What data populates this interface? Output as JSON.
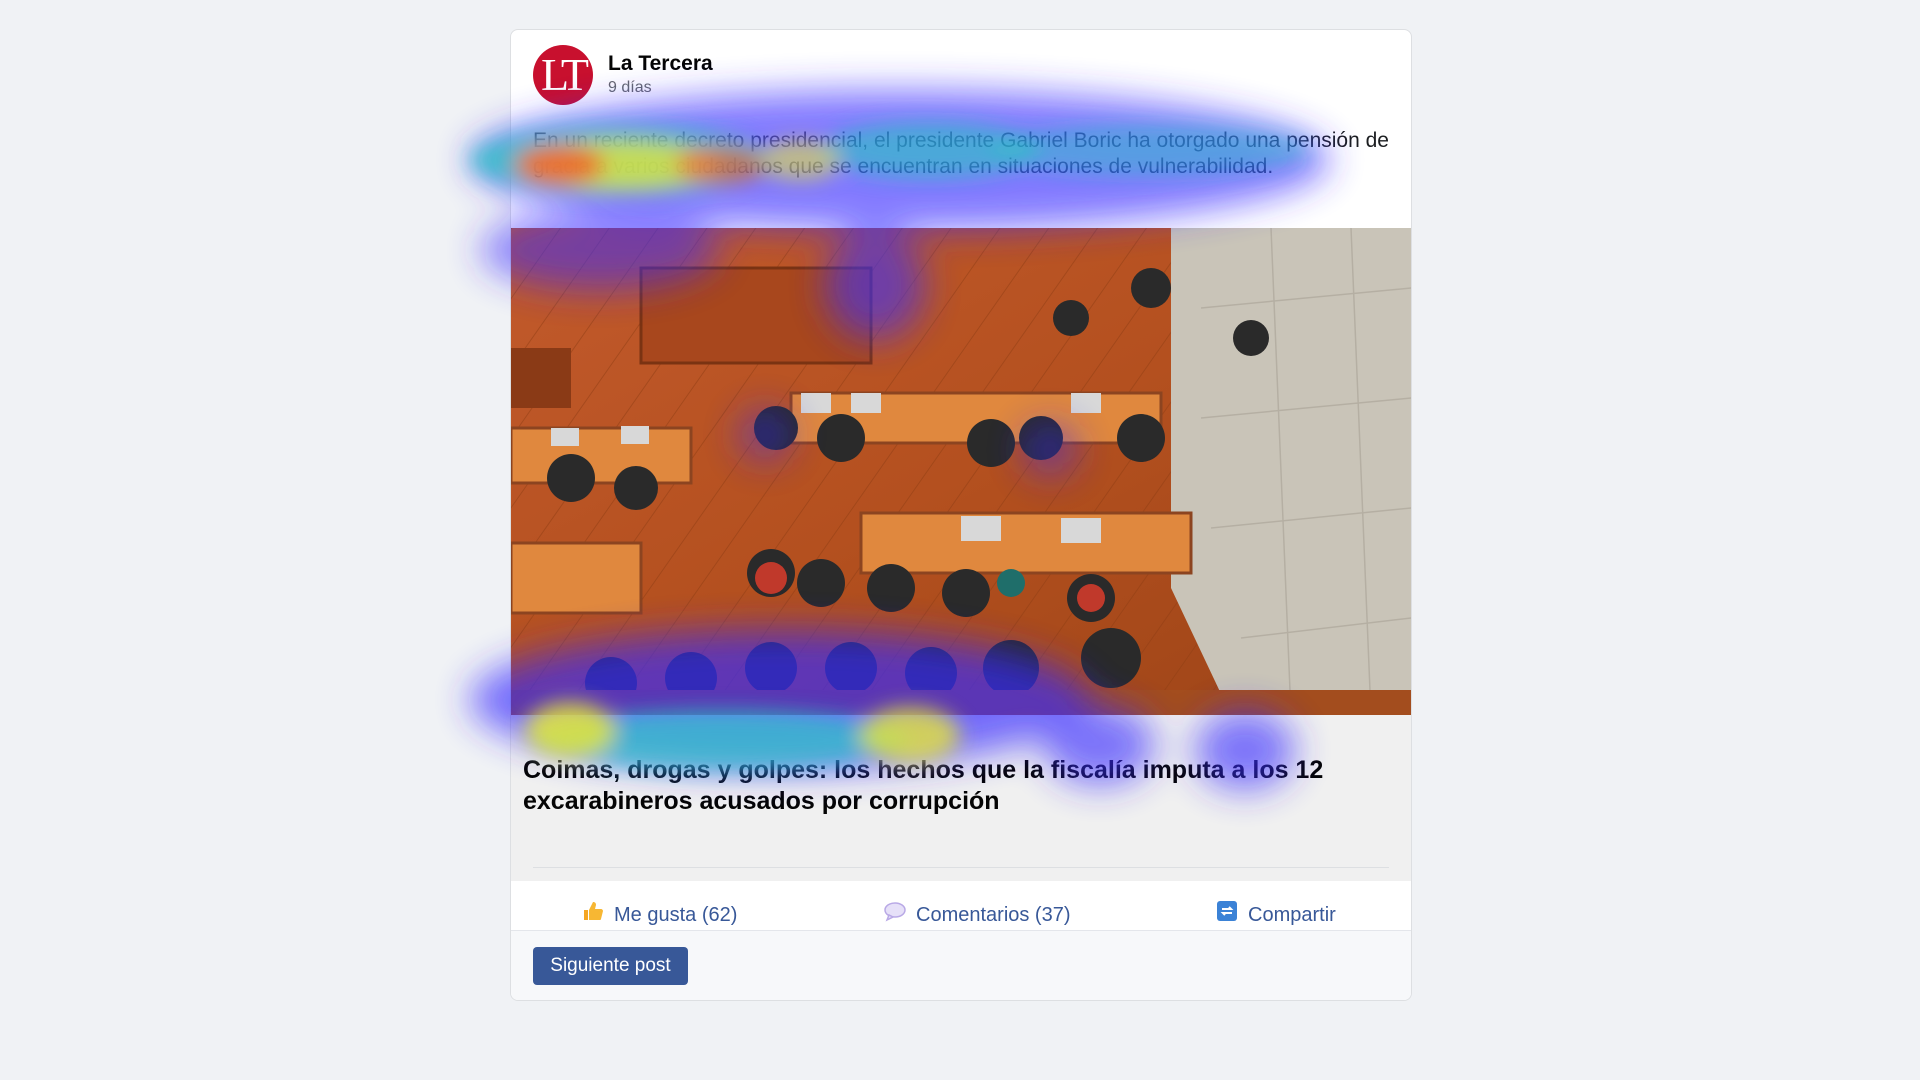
{
  "post": {
    "author": "La Tercera",
    "avatar_text": "LT",
    "time": "9 días",
    "text": "En un reciente decreto presidencial, el presidente Gabriel Boric ha otorgado una pensión de gracia a varios ciudadanos que se encuentran en situaciones de vulnerabilidad.",
    "headline": "Coimas, drogas y golpes: los hechos que la fiscalía imputa a los 12 excarabineros acusados por corrupción"
  },
  "actions": {
    "like": {
      "label": "Me gusta (62)",
      "icon": "thumbs-up-icon"
    },
    "comment": {
      "label": "Comentarios (37)",
      "icon": "speech-bubble-icon"
    },
    "share": {
      "label": "Compartir",
      "icon": "share-icon"
    }
  },
  "footer": {
    "next_label": "Siguiente post"
  },
  "colors": {
    "page_bg": "#f0f2f5",
    "brand_red": "#c8102e",
    "link_blue": "#385898",
    "button_blue": "#385898"
  }
}
